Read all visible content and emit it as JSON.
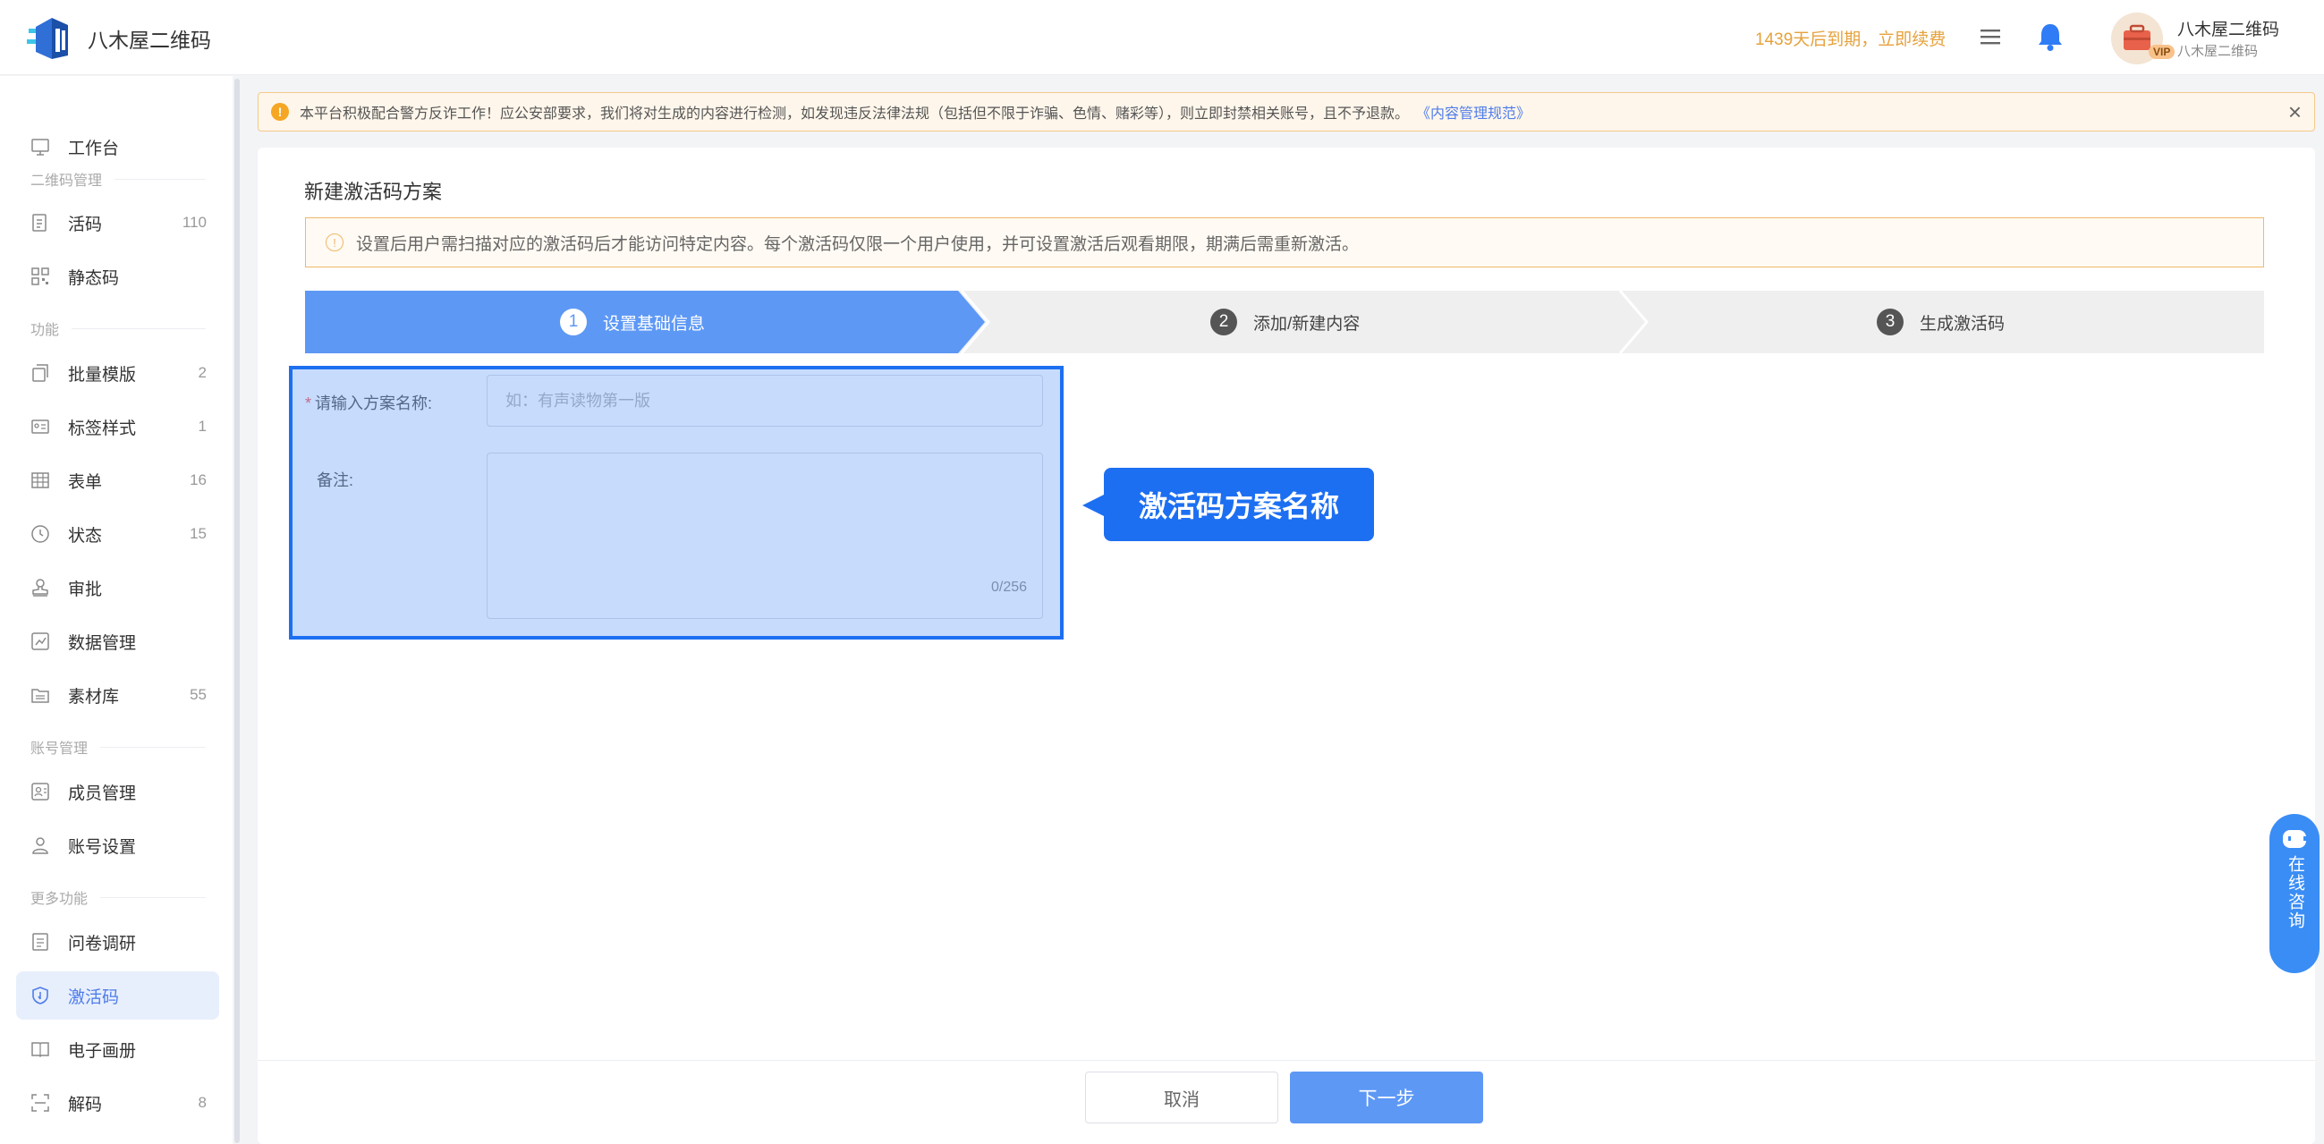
{
  "header": {
    "brand": "八木屋二维码",
    "expire_text": "1439天后到期，立即续费",
    "user_name": "八木屋二维码",
    "user_sub": "八木屋二维码",
    "vip_badge": "VIP"
  },
  "sidebar": {
    "workbench": "工作台",
    "sections": [
      "二维码管理",
      "功能",
      "账号管理",
      "更多功能"
    ],
    "items": [
      {
        "label": "活码",
        "count": "110",
        "icon": "page-icon"
      },
      {
        "label": "静态码",
        "count": "",
        "icon": "qr-icon"
      },
      {
        "label": "批量模版",
        "count": "2",
        "icon": "copy-icon"
      },
      {
        "label": "标签样式",
        "count": "1",
        "icon": "tag-card-icon"
      },
      {
        "label": "表单",
        "count": "16",
        "icon": "table-icon"
      },
      {
        "label": "状态",
        "count": "15",
        "icon": "status-icon"
      },
      {
        "label": "审批",
        "count": "",
        "icon": "stamp-icon"
      },
      {
        "label": "数据管理",
        "count": "",
        "icon": "chart-icon"
      },
      {
        "label": "素材库",
        "count": "55",
        "icon": "folder-icon"
      },
      {
        "label": "成员管理",
        "count": "",
        "icon": "member-icon"
      },
      {
        "label": "账号设置",
        "count": "",
        "icon": "user-icon"
      },
      {
        "label": "问卷调研",
        "count": "",
        "icon": "survey-icon"
      },
      {
        "label": "激活码",
        "count": "",
        "icon": "shield-icon"
      },
      {
        "label": "电子画册",
        "count": "",
        "icon": "book-icon"
      },
      {
        "label": "解码",
        "count": "8",
        "icon": "scan-icon"
      }
    ]
  },
  "notice": {
    "text": "本平台积极配合警方反诈工作！应公安部要求，我们将对生成的内容进行检测，如发现违反法律法规（包括但不限于诈骗、色情、赌彩等），则立即封禁相关账号，且不予退款。",
    "link": "《内容管理规范》"
  },
  "main": {
    "title": "新建激活码方案",
    "tip": "设置后用户需扫描对应的激活码后才能访问特定内容。每个激活码仅限一个用户使用，并可设置激活后观看期限，期满后需重新激活。",
    "steps": [
      {
        "num": "1",
        "label": "设置基础信息"
      },
      {
        "num": "2",
        "label": "添加/新建内容"
      },
      {
        "num": "3",
        "label": "生成激活码"
      }
    ],
    "form": {
      "name_required": "*",
      "name_label": "请输入方案名称:",
      "name_placeholder": "如：有声读物第一版",
      "remark_label": "备注:",
      "remark_counter": "0/256"
    },
    "callout": "激活码方案名称",
    "cancel": "取消",
    "next": "下一步"
  },
  "consult": "在线咨询",
  "colors": {
    "accent": "#5d98f5",
    "highlight": "#1d6ff2",
    "warning": "#e6a23c"
  }
}
